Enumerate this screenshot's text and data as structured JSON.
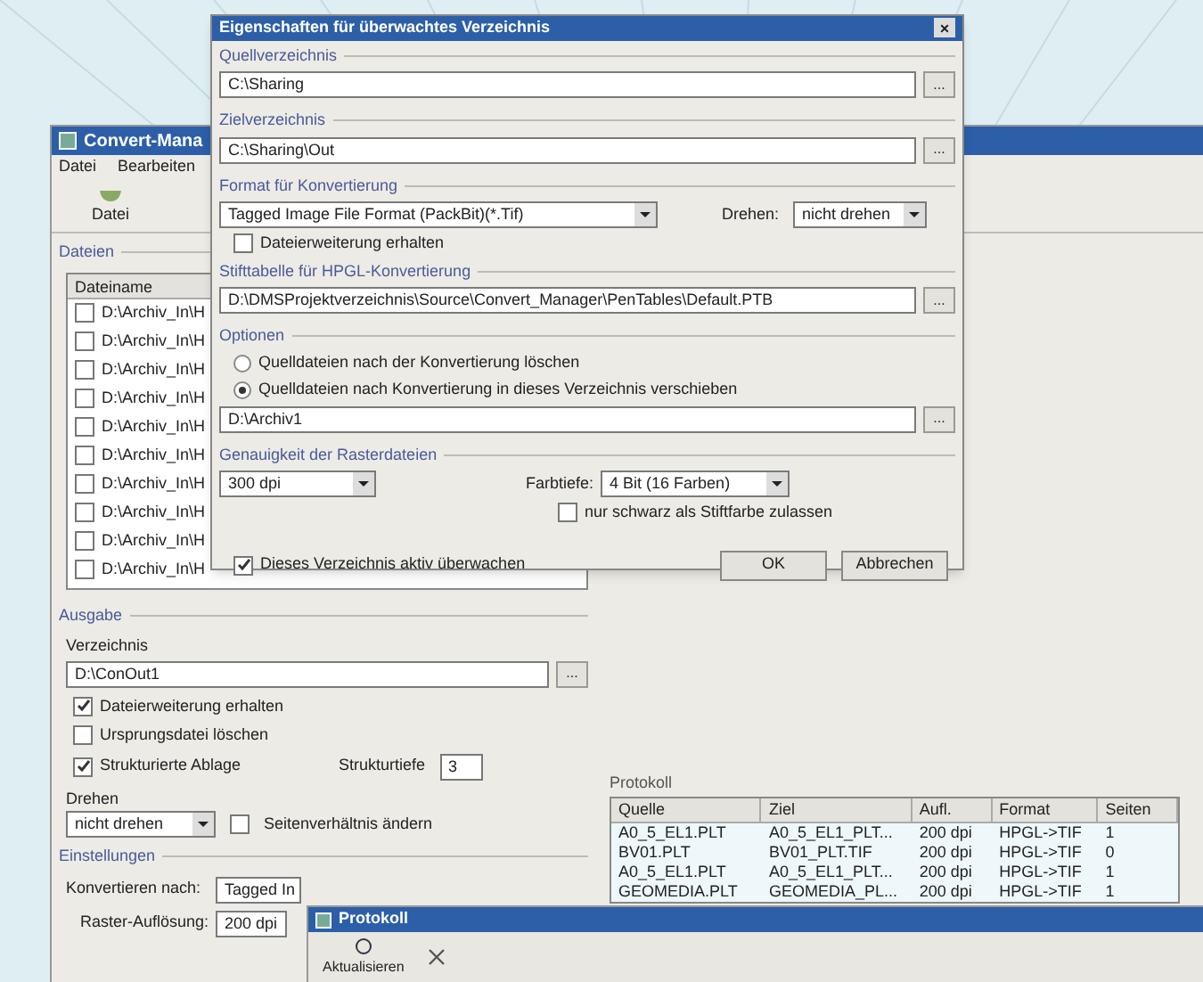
{
  "main_window": {
    "title": "Convert-Mana",
    "menu": [
      "Datei",
      "Bearbeiten"
    ],
    "toolbar": [
      {
        "label": "Datei"
      }
    ],
    "files": {
      "group": "Dateien",
      "column": "Dateiname",
      "rows": [
        {
          "name": "D:\\Archiv_In\\H",
          "checked": false
        },
        {
          "name": "D:\\Archiv_In\\H",
          "checked": false
        },
        {
          "name": "D:\\Archiv_In\\H",
          "checked": false
        },
        {
          "name": "D:\\Archiv_In\\H",
          "checked": false
        },
        {
          "name": "D:\\Archiv_In\\H",
          "checked": false
        },
        {
          "name": "D:\\Archiv_In\\H",
          "checked": false
        },
        {
          "name": "D:\\Archiv_In\\H",
          "checked": false
        },
        {
          "name": "D:\\Archiv_In\\H",
          "checked": false
        },
        {
          "name": "D:\\Archiv_In\\H",
          "checked": false
        },
        {
          "name": "D:\\Archiv_In\\H",
          "checked": false
        }
      ]
    },
    "output": {
      "group": "Ausgabe",
      "dir_label": "Verzeichnis",
      "dir_value": "D:\\ConOut1",
      "browse": "...",
      "checks": [
        {
          "label": "Dateierweiterung erhalten",
          "checked": true
        },
        {
          "label": "Ursprungsdatei löschen",
          "checked": false
        },
        {
          "label": "Strukturierte Ablage",
          "checked": true
        }
      ],
      "depth_label": "Strukturtiefe",
      "depth_value": "3",
      "rotate_label": "Drehen",
      "rotate_value": "nicht drehen",
      "aspect": {
        "label": "Seitenverhältnis ändern",
        "checked": false
      }
    },
    "settings": {
      "group": "Einstellungen",
      "convert_label": "Konvertieren nach:",
      "convert_value": "Tagged In",
      "resolution_label": "Raster-Auflösung:",
      "resolution_value": "200 dpi"
    },
    "log": {
      "label": "Protokoll",
      "columns": [
        "Quelle",
        "Ziel",
        "Aufl.",
        "Format",
        "Seiten"
      ],
      "rows": [
        [
          "A0_5_EL1.PLT",
          "A0_5_EL1_PLT...",
          "200 dpi",
          "HPGL->TIF",
          "1"
        ],
        [
          "BV01.PLT",
          "BV01_PLT.TIF",
          "200 dpi",
          "HPGL->TIF",
          "0"
        ],
        [
          "A0_5_EL1.PLT",
          "A0_5_EL1_PLT...",
          "200 dpi",
          "HPGL->TIF",
          "1"
        ],
        [
          "GEOMEDIA.PLT",
          "GEOMEDIA_PL...",
          "200 dpi",
          "HPGL->TIF",
          "1"
        ]
      ]
    }
  },
  "log_window": {
    "title": "Protokoll",
    "button": "Aktualisieren"
  },
  "dialog": {
    "title": "Eigenschaften für überwachtes Verzeichnis",
    "close": "×",
    "source_label": "Quellverzeichnis",
    "source_value": "C:\\Sharing",
    "target_label": "Zielverzeichnis",
    "target_value": "C:\\Sharing\\Out",
    "format_label": "Format für Konvertierung",
    "format_value": "Tagged Image File Format (PackBit)(*.Tif)",
    "rotate_label": "Drehen:",
    "rotate_value": "nicht drehen",
    "keep_ext": {
      "label": "Dateierweiterung erhalten",
      "checked": false
    },
    "pen_label": "Stifttabelle für HPGL-Konvertierung",
    "pen_value": "D:\\DMSProjektverzeichnis\\Source\\Convert_Manager\\PenTables\\Default.PTB",
    "options_label": "Optionen",
    "options": [
      {
        "label": "Quelldateien nach der Konvertierung löschen",
        "selected": false
      },
      {
        "label": "Quelldateien nach Konvertierung in dieses Verzeichnis verschieben",
        "selected": true
      }
    ],
    "move_value": "D:\\Archiv1",
    "raster_label": "Genauigkeit der Rasterdateien",
    "dpi_value": "300 dpi",
    "depth_label": "Farbtiefe:",
    "depth_value": "4 Bit (16 Farben)",
    "black": {
      "label": "nur schwarz als Stiftfarbe zulassen",
      "checked": false
    },
    "watch": {
      "label": "Dieses Verzeichnis aktiv überwachen",
      "checked": true
    },
    "buttons": [
      "OK",
      "Abbrechen"
    ],
    "browse": "..."
  }
}
